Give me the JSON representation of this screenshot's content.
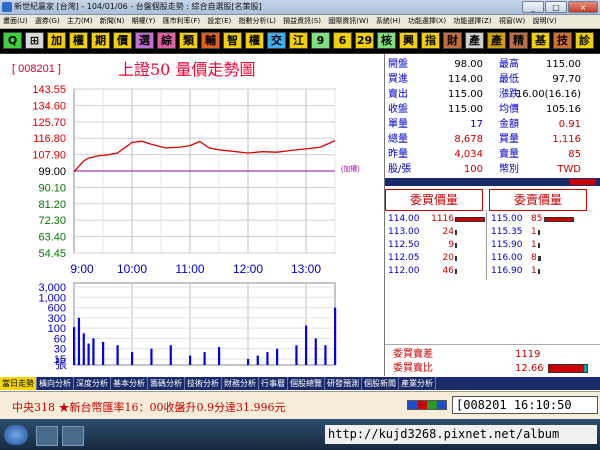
{
  "window": {
    "title": "新世紀贏家 [台灣] - 104/01/06 - 台盤個股走勢 : 綜合自選股[名策股]",
    "minimize_glyph": "_",
    "maximize_glyph": "□",
    "close_glyph": "×"
  },
  "menu": {
    "items": [
      "畫面(U)",
      "選券(G)",
      "主力(M)",
      "新聞(N)",
      "期權(Y)",
      "匯市利率(F)",
      "設定(E)",
      "指數分析(L)",
      "損益資訊(S)",
      "國際資訊(W)",
      "系統(H)",
      "功能選擇(X)",
      "功能選擇(Z)",
      "視窗(W)",
      "說明(V)"
    ]
  },
  "toolbar": {
    "buttons": [
      {
        "label": "Q",
        "bg": "#3fd040"
      },
      {
        "label": "⊞",
        "bg": "#d9d9d9"
      },
      {
        "label": "加",
        "bg": "#f0d000"
      },
      {
        "label": "權",
        "bg": "#f0d000"
      },
      {
        "label": "期",
        "bg": "#f0d000"
      },
      {
        "label": "價",
        "bg": "#f0d000"
      },
      {
        "label": "選",
        "bg": "#c070d0"
      },
      {
        "label": "綜",
        "bg": "#e060a0"
      },
      {
        "label": "類",
        "bg": "#f0d000"
      },
      {
        "label": "輔",
        "bg": "#e06020"
      },
      {
        "label": "智",
        "bg": "#f0d000"
      },
      {
        "label": "權",
        "bg": "#f0d000"
      },
      {
        "label": "交",
        "bg": "#40b0f0"
      },
      {
        "label": "江",
        "bg": "#f0d000"
      },
      {
        "label": "9",
        "bg": "#80e080"
      },
      {
        "label": "6",
        "bg": "#f0d000"
      },
      {
        "label": "29",
        "bg": "#f0d000"
      },
      {
        "label": "核",
        "bg": "#80e080"
      },
      {
        "label": "興",
        "bg": "#f0d000"
      },
      {
        "label": "指",
        "bg": "#f0d000"
      },
      {
        "label": "財",
        "bg": "#c07040"
      },
      {
        "label": "產",
        "bg": "#d0d0d0"
      },
      {
        "label": "產",
        "bg": "#d0a000"
      },
      {
        "label": "精",
        "bg": "#c07040"
      },
      {
        "label": "基",
        "bg": "#f0d000"
      },
      {
        "label": "技",
        "bg": "#d07030"
      },
      {
        "label": "診",
        "bg": "#f0d000"
      }
    ]
  },
  "chart_panel": {
    "code": "[ 008201 ]",
    "title": "上證50  量價走勢圖",
    "reference_label": "(加權)"
  },
  "chart_data": {
    "type": "line",
    "title": "上證50  量價走勢圖",
    "x_ticks": [
      "9:00",
      "10:00",
      "11:00",
      "12:00",
      "13:00"
    ],
    "price_ticks": [
      "143.55",
      "134.60",
      "125.70",
      "116.80",
      "107.90",
      "99.00",
      "90.10",
      "81.20",
      "72.30",
      "63.40",
      "54.45"
    ],
    "price_ylim": [
      54.45,
      143.55
    ],
    "reference_price": 99.0,
    "price_series": {
      "name": "價",
      "x": [
        "9:00",
        "9:05",
        "9:10",
        "9:15",
        "9:25",
        "9:35",
        "9:45",
        "10:00",
        "10:10",
        "10:20",
        "10:35",
        "10:50",
        "11:00",
        "11:10",
        "11:20",
        "11:30",
        "12:00",
        "12:15",
        "12:30",
        "12:45",
        "13:00",
        "13:15",
        "13:30"
      ],
      "values": [
        98.6,
        101.5,
        104.5,
        106.0,
        107.2,
        107.8,
        108.8,
        114.5,
        115.2,
        113.5,
        111.5,
        112.0,
        112.8,
        115.0,
        111.5,
        110.5,
        108.8,
        109.5,
        109.2,
        110.2,
        111.0,
        112.0,
        115.5
      ]
    },
    "volume_ticks": [
      "3,000",
      "1,000",
      "600",
      "300",
      "100",
      "60",
      "30",
      "15"
    ],
    "volume_unit_label": "張",
    "volume_series": {
      "name": "量",
      "x": [
        "9:00",
        "9:05",
        "9:10",
        "9:15",
        "9:20",
        "9:30",
        "9:45",
        "10:00",
        "10:20",
        "10:40",
        "11:00",
        "11:15",
        "11:30",
        "12:00",
        "12:10",
        "12:20",
        "12:30",
        "12:50",
        "13:00",
        "13:10",
        "13:20",
        "13:30"
      ],
      "values": [
        120,
        300,
        80,
        45,
        60,
        50,
        40,
        25,
        30,
        40,
        20,
        25,
        35,
        15,
        20,
        25,
        30,
        40,
        150,
        60,
        40,
        600
      ]
    },
    "grid": true
  },
  "quote": {
    "stats": [
      {
        "l1": "開盤",
        "v1": "98.00",
        "c1": "#000000",
        "l2": "最高",
        "v2": "115.00",
        "c2": "#000000"
      },
      {
        "l1": "買進",
        "v1": "114.00",
        "c1": "#000000",
        "l2": "最低",
        "v2": "97.70",
        "c2": "#000000"
      },
      {
        "l1": "賣出",
        "v1": "115.00",
        "c1": "#000000",
        "l2": "漲跌",
        "v2": "16.00(16.16)",
        "c2": "#000000"
      },
      {
        "l1": "收盤",
        "v1": "115.00",
        "c1": "#000000",
        "l2": "均價",
        "v2": "105.16",
        "c2": "#000000"
      },
      {
        "l1": "單量",
        "v1": "17",
        "c1": "#0000cc",
        "l2": "金額",
        "v2": "0.91",
        "c2": "#cc0000"
      },
      {
        "l1": "總量",
        "v1": "8,678",
        "c1": "#cc0000",
        "l2": "買量",
        "v2": "1,116",
        "c2": "#cc0000"
      },
      {
        "l1": "昨量",
        "v1": "4,034",
        "c1": "#cc0000",
        "l2": "賣量",
        "v2": "85",
        "c2": "#cc0000"
      },
      {
        "l1": "股/張",
        "v1": "100",
        "c1": "#cc0000",
        "l2": "幣別",
        "v2": "TWD",
        "c2": "#cc0000"
      }
    ],
    "bid_header": "委買價量",
    "ask_header": "委賣價量",
    "bids": [
      {
        "price": "114.00",
        "qty": "1116"
      },
      {
        "price": "113.00",
        "qty": "24"
      },
      {
        "price": "112.50",
        "qty": "9"
      },
      {
        "price": "112.05",
        "qty": "20"
      },
      {
        "price": "112.00",
        "qty": "46"
      }
    ],
    "asks": [
      {
        "price": "115.00",
        "qty": "85"
      },
      {
        "price": "115.35",
        "qty": "1"
      },
      {
        "price": "115.90",
        "qty": "1"
      },
      {
        "price": "116.00",
        "qty": "8"
      },
      {
        "price": "116.90",
        "qty": "1"
      }
    ],
    "diff_label": "委買賣差",
    "diff_value": "1119",
    "ratio_label": "委買賣比",
    "ratio_value": "12.66",
    "ratio_level": 0.92
  },
  "bottom_tabs": [
    "當日走勢",
    "橫向分析",
    "深度分析",
    "基本分析",
    "籌碼分析",
    "技術分析",
    "財務分析",
    "行事曆",
    "個股總覽",
    "研發預測",
    "個股新聞",
    "產業分析"
  ],
  "ticker": {
    "text": "中央318  ★新台幣匯率16：00收盤升0.9分達31.996元",
    "code": "[008201",
    "time": "16:10:50"
  },
  "taskbar": {
    "url": "http://kujd3268.pixnet.net/album"
  }
}
